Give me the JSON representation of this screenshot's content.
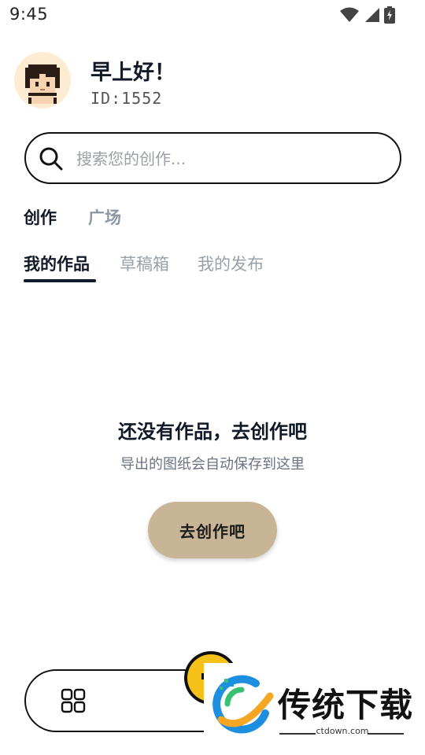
{
  "status_bar": {
    "time": "9:45",
    "icons": [
      "wifi-icon",
      "cell-signal-icon",
      "battery-charging-icon"
    ]
  },
  "header": {
    "greeting": "早上好！",
    "user_id": "ID:1552",
    "avatar_icon": "pixel-avatar-icon"
  },
  "search": {
    "placeholder": "搜索您的创作..."
  },
  "main_tabs": [
    {
      "label": "创作",
      "active": true
    },
    {
      "label": "广场",
      "active": false
    }
  ],
  "sub_tabs": [
    {
      "label": "我的作品",
      "active": true
    },
    {
      "label": "草稿箱",
      "active": false
    },
    {
      "label": "我的发布",
      "active": false
    }
  ],
  "empty_state": {
    "title": "还没有作品，去创作吧",
    "subtitle": "导出的图纸会自动保存到这里",
    "button_label": "去创作吧"
  },
  "bottom_nav": {
    "icons": [
      "grid-icon",
      "emoji-face-icon"
    ]
  },
  "watermark": {
    "title": "传统下载",
    "url": "ctdown.com"
  },
  "colors": {
    "accent_button": "#c8b595",
    "avatar_bg": "#fdecd2",
    "text_primary": "#111827",
    "text_muted": "#8e96a3"
  }
}
